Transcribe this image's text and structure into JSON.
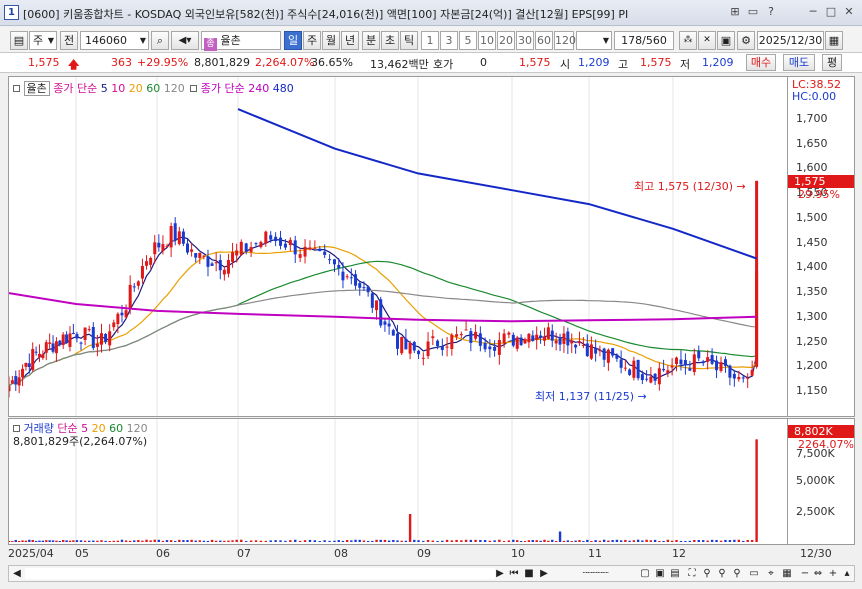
{
  "window": {
    "icon_label": "1",
    "title": "[0600] 키움종합차트 - KOSDAQ 외국인보유[582(천)] 주식수[24,016(천)] 액면[100] 자본금[24(억)] 결산[12월] EPS[99] PI",
    "controls": [
      "⊞",
      "▭",
      "?",
      "─",
      "□",
      "✕"
    ]
  },
  "toolbar": {
    "stock_code": "146060",
    "type_label": "주",
    "prev_label": "전",
    "stock_name": "율촌",
    "periods": [
      "일",
      "주",
      "월",
      "년",
      "분",
      "초",
      "틱"
    ],
    "active_period": "일",
    "intervals": [
      "1",
      "3",
      "5",
      "10",
      "20",
      "30",
      "60",
      "120"
    ],
    "count": "178/560",
    "date": "2025/12/30"
  },
  "quote": {
    "price": "1,575",
    "change": "363",
    "change_pct": "+29.95%",
    "volume": "8,801,829",
    "volume_pct": "2,264.07%",
    "turnover": "36.65%",
    "amount": "13,462백만",
    "hoga_label": "호가",
    "hoga_value": "0",
    "hoga_price": "1,575",
    "open_label": "시",
    "open": "1,209",
    "high_label": "고",
    "high": "1,575",
    "low_label": "저",
    "low": "1,209",
    "buy_label": "매수",
    "sell_label": "매도",
    "eval_label": "평"
  },
  "legend": {
    "price": {
      "name": "율촌",
      "ma_label": "종가 단순",
      "periods": [
        "5",
        "10",
        "20",
        "60",
        "120"
      ],
      "ma2_label": "종가 단순",
      "ma2_periods": [
        "240",
        "480"
      ]
    },
    "volume": {
      "name": "거래량",
      "ma_label": "단순",
      "periods": [
        "5",
        "20",
        "60",
        "120"
      ],
      "value_text": "8,801,829주(2,264.07%)"
    }
  },
  "annotations": {
    "high": "최고 1,575 (12/30)",
    "low": "최저 1,137 (11/25)"
  },
  "price_scale": {
    "lc": "LC:38.52",
    "hc": "HC:0.00",
    "ticks": [
      "1,700",
      "1,650",
      "1,600",
      "1,550",
      "1,500",
      "1,450",
      "1,400",
      "1,350",
      "1,300",
      "1,250",
      "1,200",
      "1,150"
    ],
    "current_price": "1,575",
    "current_pct": "29.95%"
  },
  "volume_scale": {
    "current": "8,802K",
    "pct": "2264.07%",
    "ticks": [
      "7,500K",
      "5,000K",
      "2,500K"
    ]
  },
  "x_axis": {
    "labels": [
      "2025/04",
      "05",
      "06",
      "07",
      "08",
      "09",
      "10",
      "11",
      "12",
      "12/30"
    ]
  },
  "colors": {
    "up": "#e01818",
    "down": "#1a3bd0",
    "ma5": "#1a1a80",
    "ma10": "#d01090",
    "ma20": "#e8a000",
    "ma60": "#1a8a30",
    "ma120": "#888888",
    "ma240": "#c000c0",
    "ma480": "#1428c8"
  },
  "chart_data": {
    "type": "candlestick",
    "x_range": [
      "2025/04",
      "2025/12/30"
    ],
    "ylim": [
      1130,
      1720
    ],
    "series": [
      {
        "name": "480",
        "values": [
          [
            7,
            1720
          ],
          [
            8,
            1640
          ],
          [
            9,
            1590
          ],
          [
            10,
            1556
          ],
          [
            11,
            1528
          ],
          [
            12,
            1478
          ],
          [
            12.95,
            1418
          ]
        ]
      },
      {
        "name": "240",
        "values": [
          [
            4,
            1348
          ],
          [
            5,
            1326
          ],
          [
            6,
            1312
          ],
          [
            7,
            1306
          ],
          [
            8,
            1300
          ],
          [
            9,
            1294
          ],
          [
            10,
            1291
          ],
          [
            11,
            1293
          ],
          [
            12,
            1295
          ],
          [
            12.95,
            1300
          ]
        ]
      }
    ],
    "last_close": 1575,
    "high": {
      "value": 1575,
      "date": "12/30"
    },
    "low": {
      "value": 1137,
      "date": "11/25"
    }
  }
}
